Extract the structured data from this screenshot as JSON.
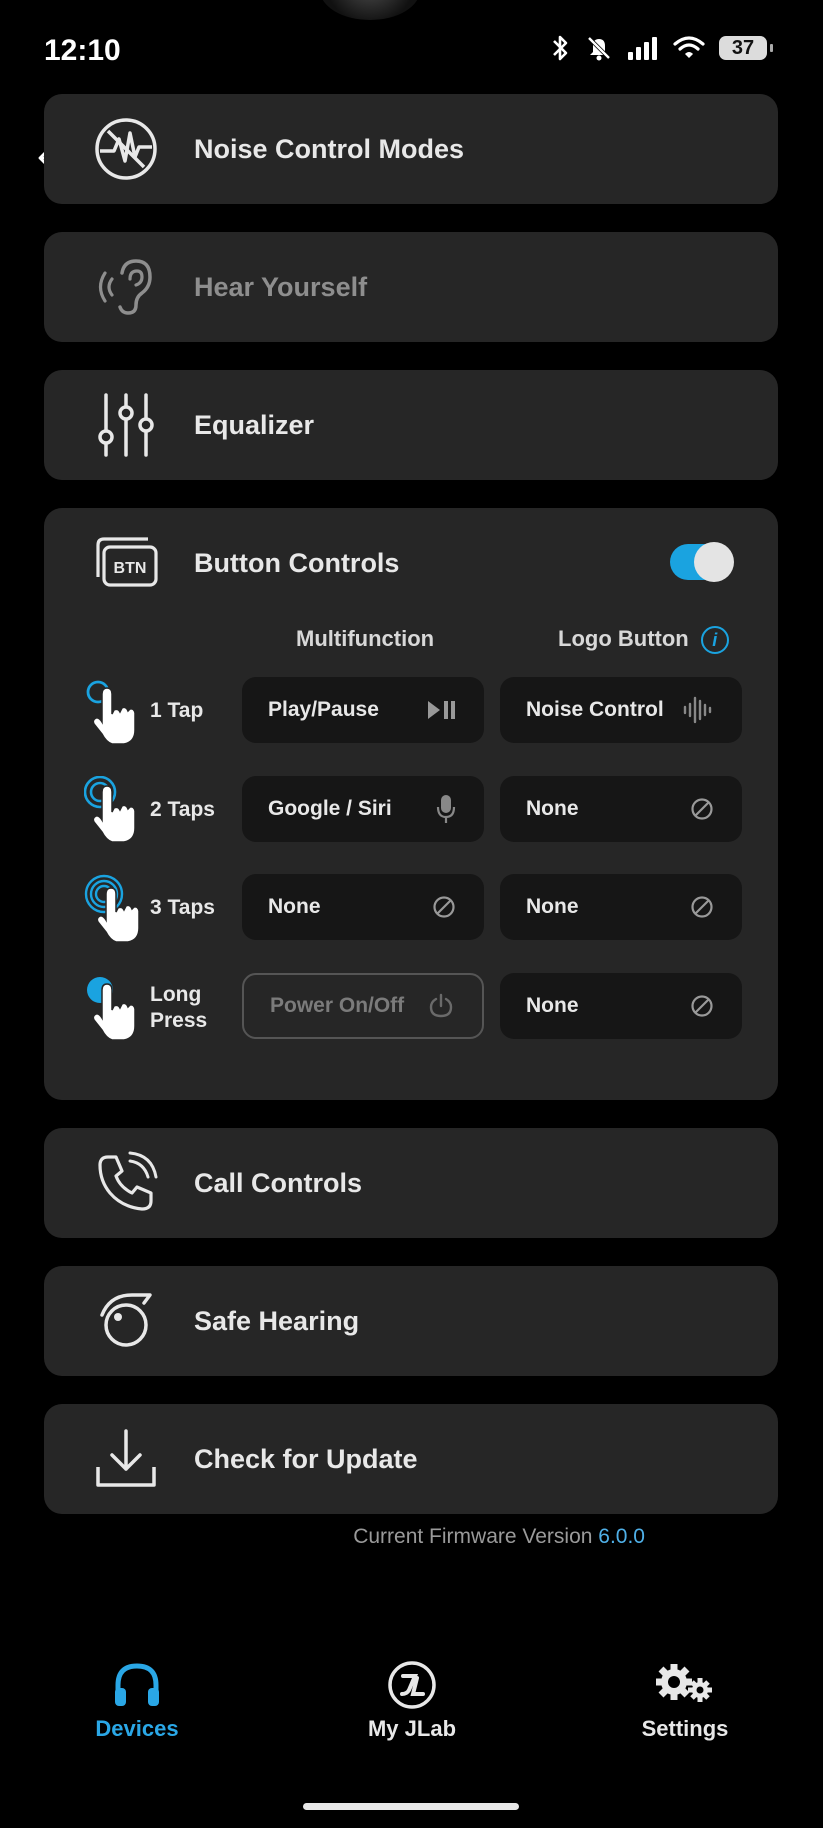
{
  "status_bar": {
    "time": "12:10",
    "battery": "37"
  },
  "menu": {
    "noise_control": "Noise Control Modes",
    "hear_yourself": "Hear Yourself",
    "equalizer": "Equalizer",
    "button_controls": "Button Controls",
    "call_controls": "Call Controls",
    "safe_hearing": "Safe Hearing",
    "check_update": "Check for Update"
  },
  "button_controls": {
    "enabled": true,
    "col_multifunction": "Multifunction",
    "col_logo": "Logo Button",
    "rows": [
      {
        "label": "1 Tap",
        "multifunction": "Play/Pause",
        "multifunction_icon": "play-pause-icon",
        "logo": "Noise Control",
        "logo_icon": "sound-wave-icon"
      },
      {
        "label": "2 Taps",
        "multifunction": "Google / Siri",
        "multifunction_icon": "microphone-icon",
        "logo": "None",
        "logo_icon": "none-icon"
      },
      {
        "label": "3 Taps",
        "multifunction": "None",
        "multifunction_icon": "none-icon",
        "logo": "None",
        "logo_icon": "none-icon"
      },
      {
        "label_line1": "Long",
        "label_line2": "Press",
        "multifunction": "Power On/Off",
        "multifunction_icon": "power-icon",
        "logo": "None",
        "logo_icon": "none-icon"
      }
    ]
  },
  "firmware": {
    "label": "Current Firmware Version",
    "version": "6.0.0"
  },
  "nav": {
    "devices": "Devices",
    "my_jlab": "My JLab",
    "settings": "Settings"
  },
  "colors": {
    "accent": "#1aa3e0",
    "card": "#262626",
    "background": "#000000"
  }
}
